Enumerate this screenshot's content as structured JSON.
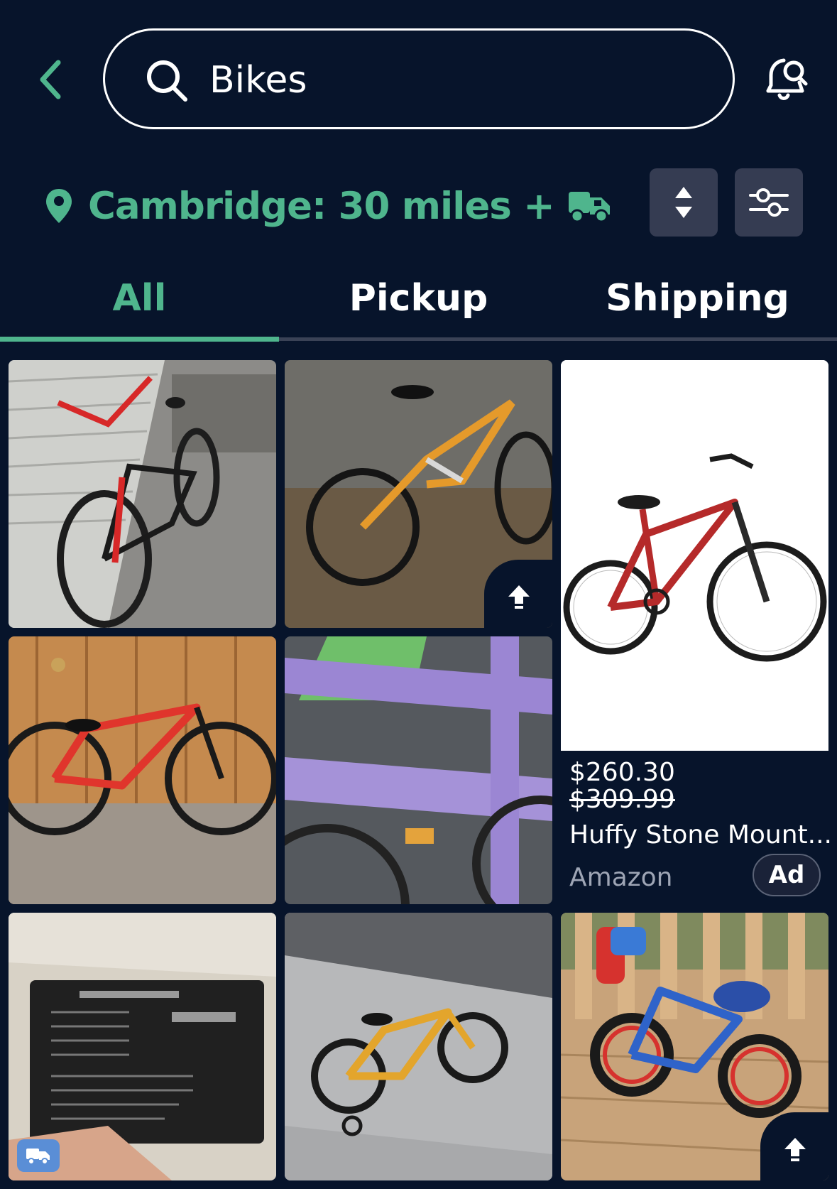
{
  "header": {
    "search_query": "Bikes",
    "location_text": "Cambridge: 30 miles +"
  },
  "tabs": [
    {
      "label": "All",
      "selected": true
    },
    {
      "label": "Pickup",
      "selected": false
    },
    {
      "label": "Shipping",
      "selected": false
    }
  ],
  "ad": {
    "price": "$260.30",
    "original_price": "$309.99",
    "title": "Huffy Stone Mount...",
    "seller": "Amazon",
    "badge": "Ad"
  },
  "listings": [
    {
      "image": "red BMX bike beside house siding"
    },
    {
      "image": "orange mountain bike against wall",
      "boosted": true
    },
    {
      "image": "red Trek kids bike on wood wall"
    },
    {
      "image": "purple Giant bike frame closeup"
    },
    {
      "image": "lithium ion battery",
      "shipping": true
    },
    {
      "image": "yellow kids bike with training wheels"
    },
    {
      "image": "red and blue Spider-Man kids bike on deck",
      "boosted": true
    }
  ],
  "colors": {
    "background": "#07142b",
    "accent": "#4fb58d",
    "button_bg": "#353c52"
  }
}
